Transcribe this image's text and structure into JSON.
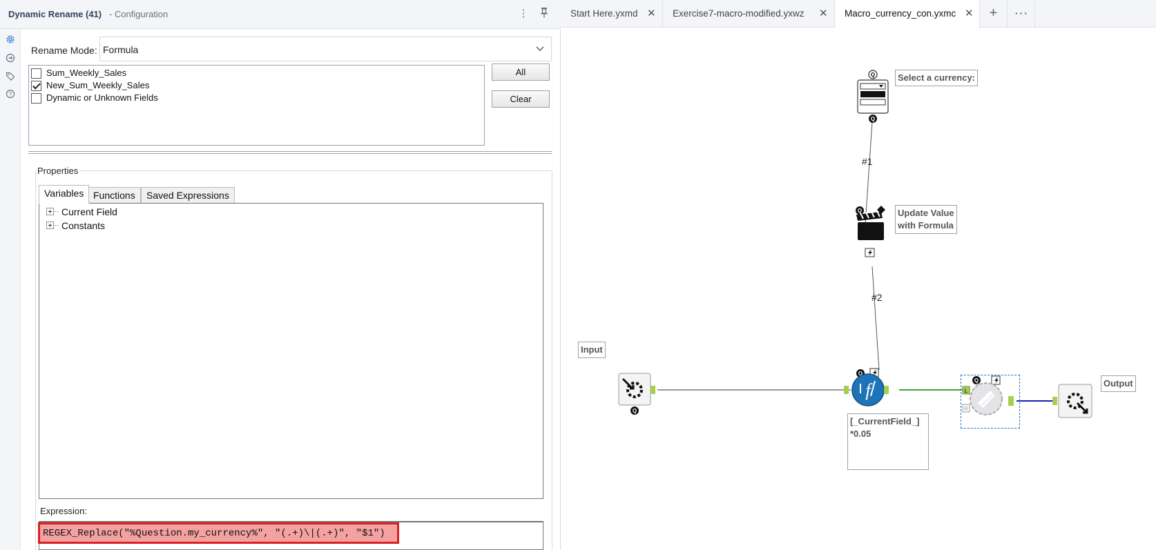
{
  "config": {
    "title": "Dynamic Rename (41)",
    "subtitle": "- Configuration",
    "menu_icon": "kebab-menu-icon",
    "pin_icon": "pin-icon",
    "rail_icons": [
      "gear-icon",
      "connection-icon",
      "tag-icon",
      "help-icon"
    ],
    "rename_mode_label": "Rename Mode:",
    "rename_mode_value": "Formula",
    "fields": [
      {
        "label": "Sum_Weekly_Sales",
        "checked": false
      },
      {
        "label": "New_Sum_Weekly_Sales",
        "checked": true
      },
      {
        "label": "Dynamic or Unknown Fields",
        "checked": false
      }
    ],
    "all_button": "All",
    "clear_button": "Clear",
    "properties_label": "Properties",
    "tabs": [
      "Variables",
      "Functions",
      "Saved Expressions"
    ],
    "active_tab": "Variables",
    "tree": [
      "Current Field",
      "Constants"
    ],
    "expression_label": "Expression:",
    "expression": "REGEX_Replace(\"%Question.my_currency%\", \"(.+)\\|(.+)\", \"$1\")"
  },
  "canvas": {
    "tabs": [
      {
        "label": "Start Here.yxmd",
        "active": false
      },
      {
        "label": "Exercise7-macro-modified.yxwz",
        "active": false
      },
      {
        "label": "Macro_currency_con.yxmc",
        "active": true
      }
    ],
    "add_tab": "+",
    "more_tabs": "···",
    "annotations": {
      "select_currency": "Select a currency:",
      "update_value_line1": "Update Value",
      "update_value_line2": "with Formula",
      "input": "Input",
      "output": "Output",
      "formula_line1": "[_CurrentField_]",
      "formula_line2": "*0.05"
    },
    "connection_labels": [
      "#1",
      "#2"
    ],
    "tools": [
      "drop-down-tool-icon",
      "action-tool-icon",
      "macro-input-icon",
      "formula-tool-icon",
      "join-tool-icon",
      "macro-output-icon"
    ],
    "colors": {
      "formula_tool": "#1e74b8",
      "output_anchor": "#a6cf52",
      "green_connection": "#3aa33a",
      "blue_connection": "#1b1fb0",
      "highlight_border": "#d9201f",
      "highlight_fill": "#f4a1a1"
    }
  }
}
